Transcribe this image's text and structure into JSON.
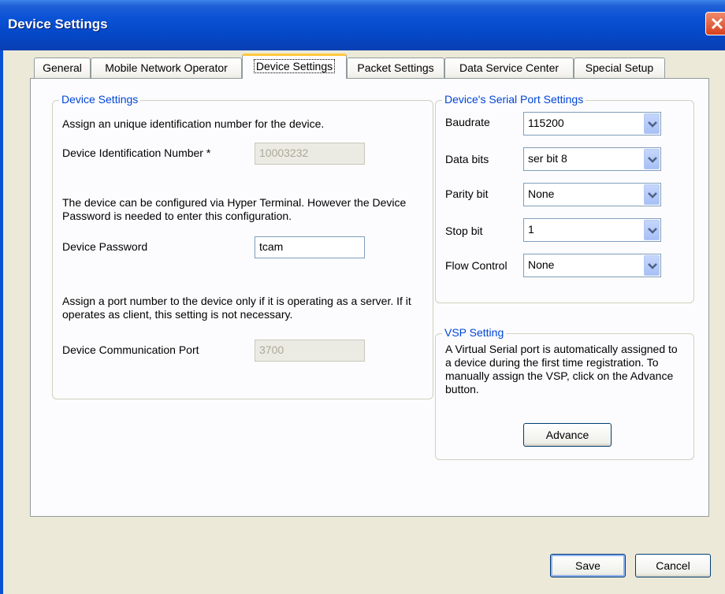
{
  "window": {
    "title": "Device Settings"
  },
  "tabs": [
    {
      "label": "General"
    },
    {
      "label": "Mobile Network Operator"
    },
    {
      "label": "Device Settings",
      "active": true
    },
    {
      "label": "Packet Settings"
    },
    {
      "label": "Data Service Center"
    },
    {
      "label": "Special Setup"
    }
  ],
  "device_settings": {
    "title": "Device Settings",
    "intro": "Assign an unique identification number for the device.",
    "id_label": "Device Identification Number *",
    "id_value": "10003232",
    "hyper_text": "The device can be configured via Hyper Terminal. However the Device Password is needed to enter this configuration.",
    "password_label": "Device Password",
    "password_value": "tcam",
    "port_text": "Assign a port number to the device only if it is operating as a server. If it operates as client, this setting is not necessary.",
    "port_label": "Device Communication Port",
    "port_value": "3700"
  },
  "serial": {
    "title": "Device's Serial Port Settings",
    "fields": [
      {
        "label": "Baudrate",
        "value": "115200"
      },
      {
        "label": "Data bits",
        "value": "ser bit 8"
      },
      {
        "label": "Parity bit",
        "value": "None"
      },
      {
        "label": "Stop bit",
        "value": "1"
      },
      {
        "label": "Flow Control",
        "value": "None"
      }
    ]
  },
  "vsp": {
    "title": "VSP Setting",
    "text": "A Virtual Serial port is automatically assigned to a device during the first time registration. To manually assign the VSP, click on the Advance button.",
    "advance_label": "Advance"
  },
  "footer": {
    "save_label": "Save",
    "cancel_label": "Cancel"
  },
  "icons": {
    "close": "close-icon",
    "dropdown": "chevron-down-icon"
  },
  "colors": {
    "titlebar": "#0a52d5",
    "group_title": "#0046d5",
    "active_tab_accent": "#ffc83c"
  }
}
